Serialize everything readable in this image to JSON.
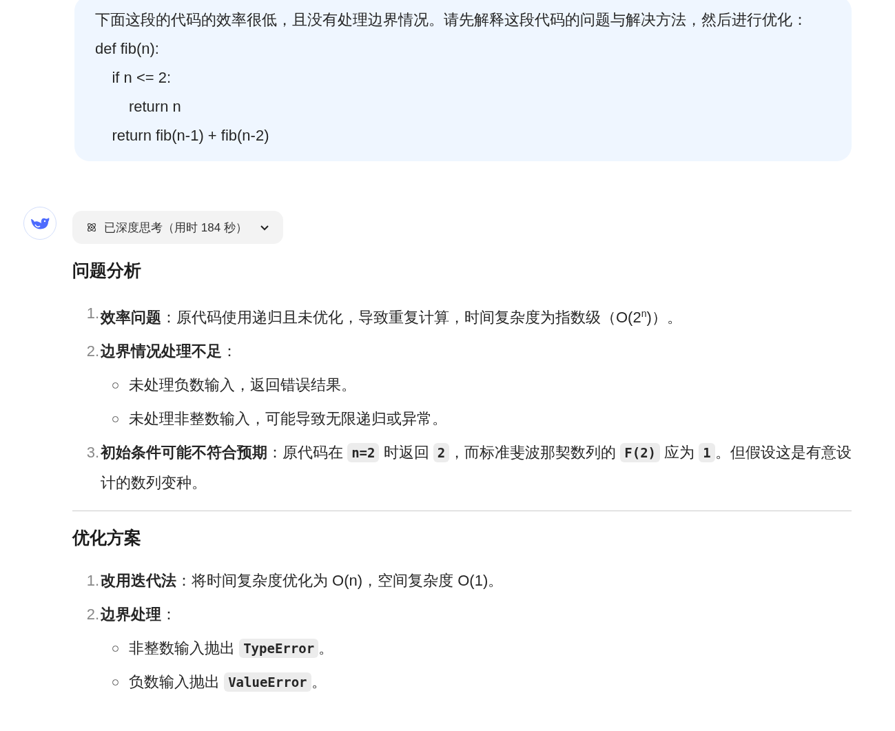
{
  "user_message": {
    "text": "下面这段的代码的效率很低，且没有处理边界情况。请先解释这段代码的问题与解决方法，然后进行优化：",
    "code_lines": [
      "def fib(n):",
      "    if n <= 2:",
      "        return n",
      "    return fib(n-1) + fib(n-2)"
    ]
  },
  "thinking": {
    "label": "已深度思考（用时 184 秒）",
    "expanded": false
  },
  "sections": [
    {
      "heading": "问题分析",
      "items": [
        {
          "number": "1.",
          "parts": [
            {
              "kind": "text",
              "text": "**效率问题**：原代码使用递归且未优化，导致重复计算，时间复杂度为指数级（O(2$^{n}$)）。"
            }
          ]
        },
        {
          "number": "2.",
          "parts": [
            {
              "kind": "text",
              "text": "**边界情况处理不足**："
            }
          ],
          "children": [
            {
              "parts": [
                {
                  "kind": "text",
                  "text": "未处理负数输入，返回错误结果。"
                }
              ]
            },
            {
              "parts": [
                {
                  "kind": "text",
                  "text": "未处理非整数输入，可能导致无限递归或异常。"
                }
              ]
            }
          ]
        },
        {
          "number": "3.",
          "parts": [
            {
              "kind": "text",
              "text": "**初始条件可能不符合预期**：原代码在 "
            },
            {
              "kind": "code",
              "text": "n=2"
            },
            {
              "kind": "text",
              "text": " 时返回 "
            },
            {
              "kind": "code",
              "text": "2"
            },
            {
              "kind": "text",
              "text": "，而标准斐波那契数列的 "
            },
            {
              "kind": "code",
              "text": "F(2)"
            },
            {
              "kind": "text",
              "text": " 应为 "
            },
            {
              "kind": "code",
              "text": "1"
            },
            {
              "kind": "text",
              "text": "。但假设这是有意设计的数列变种。"
            }
          ]
        }
      ]
    },
    {
      "heading": "优化方案",
      "items": [
        {
          "number": "1.",
          "parts": [
            {
              "kind": "text",
              "text": "**改用迭代法**：将时间复杂度优化为 O(n)，空间复杂度 O(1)。"
            }
          ]
        },
        {
          "number": "2.",
          "parts": [
            {
              "kind": "text",
              "text": "**边界处理**："
            }
          ],
          "children": [
            {
              "parts": [
                {
                  "kind": "text",
                  "text": "非整数输入抛出 "
                },
                {
                  "kind": "code",
                  "text": "TypeError"
                },
                {
                  "kind": "text",
                  "text": "。"
                }
              ]
            },
            {
              "parts": [
                {
                  "kind": "text",
                  "text": "负数输入抛出 "
                },
                {
                  "kind": "code",
                  "text": "ValueError"
                },
                {
                  "kind": "text",
                  "text": "。"
                }
              ]
            }
          ]
        }
      ]
    }
  ]
}
